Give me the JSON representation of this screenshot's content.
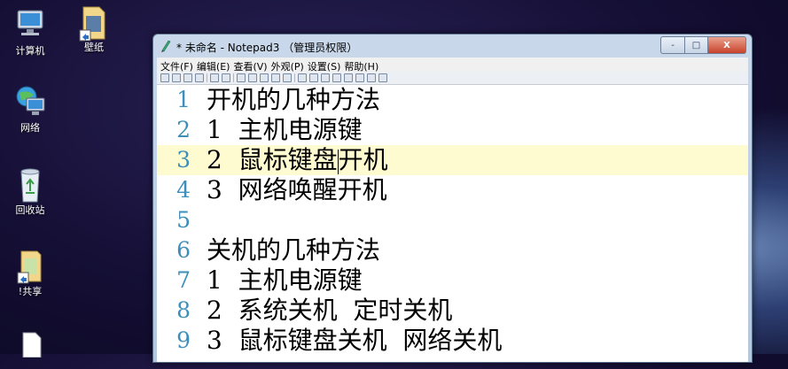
{
  "desktop": {
    "icons": [
      {
        "label": "计算机",
        "icon": "computer-icon"
      },
      {
        "label": "壁纸",
        "icon": "folder-icon"
      },
      {
        "label": "网络",
        "icon": "network-icon"
      },
      {
        "label": "回收站",
        "icon": "recycle-bin-icon"
      },
      {
        "label": "!共享",
        "icon": "shared-folder-icon"
      }
    ]
  },
  "window": {
    "title": "* 未命名 - Notepad3 （管理员权限）",
    "controls": {
      "minimize": "-",
      "maximize": "□",
      "close": "X"
    },
    "menu": [
      "文件(F)",
      "编辑(E)",
      "查看(V)",
      "外观(P)",
      "设置(S)",
      "帮助(H)"
    ]
  },
  "editor": {
    "current_line": 3,
    "lines": [
      {
        "num": "1",
        "text": "开机的几种方法"
      },
      {
        "num": "2",
        "text": "1  主机电源键"
      },
      {
        "num": "3",
        "text_before": "2  鼠标键盘",
        "text_after": "开机"
      },
      {
        "num": "4",
        "text": "3  网络唤醒开机"
      },
      {
        "num": "5",
        "text": ""
      },
      {
        "num": "6",
        "text": "关机的几种方法"
      },
      {
        "num": "7",
        "text": "1  主机电源键"
      },
      {
        "num": "8",
        "text": "2  系统关机  定时关机"
      },
      {
        "num": "9",
        "text": "3  鼠标键盘关机  网络关机"
      }
    ]
  },
  "colors": {
    "line_number": "#3c8fba",
    "current_line_bg": "#fffbd0"
  }
}
